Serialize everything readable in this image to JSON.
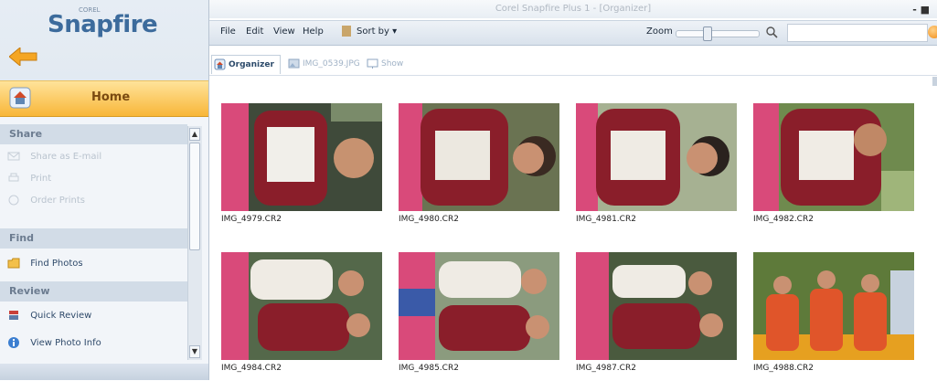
{
  "app": {
    "logo": "Snapfire",
    "logo_small": "COREL",
    "title": "Corel Snapfire Plus 1 - [Organizer]",
    "window_controls": "- ■"
  },
  "sidebar": {
    "home_label": "Home",
    "sections": [
      {
        "title": "Share",
        "items": [
          {
            "label": "Share as E-mail",
            "icon": "mail-icon",
            "enabled": false
          },
          {
            "label": "Print",
            "icon": "print-icon",
            "enabled": false
          },
          {
            "label": "Order Prints",
            "icon": "order-prints-icon",
            "enabled": false
          }
        ]
      },
      {
        "title": "Find",
        "items": [
          {
            "label": "Find Photos",
            "icon": "folder-icon",
            "enabled": true
          }
        ]
      },
      {
        "title": "Review",
        "items": [
          {
            "label": "Quick Review",
            "icon": "quick-review-icon",
            "enabled": true
          },
          {
            "label": "View Photo Info",
            "icon": "info-icon",
            "enabled": true
          }
        ]
      }
    ]
  },
  "menubar": {
    "file": "File",
    "edit": "Edit",
    "view": "View",
    "help": "Help",
    "sort_by": "Sort by ▾",
    "zoom_label": "Zoom",
    "zoom_level": 0.35,
    "search_value": ""
  },
  "tabs": [
    {
      "label": "Organizer",
      "icon": "organizer-icon",
      "active": true
    },
    {
      "label": "IMG_0539.JPG",
      "icon": "photo-icon",
      "active": false
    },
    {
      "label": "Show",
      "icon": "show-icon",
      "active": false
    }
  ],
  "photos": [
    {
      "name": "IMG_4979.CR2"
    },
    {
      "name": "IMG_4980.CR2"
    },
    {
      "name": "IMG_4981.CR2"
    },
    {
      "name": "IMG_4982.CR2"
    },
    {
      "name": "IMG_4984.CR2"
    },
    {
      "name": "IMG_4985.CR2"
    },
    {
      "name": "IMG_4987.CR2"
    },
    {
      "name": "IMG_4988.CR2"
    }
  ],
  "colors": {
    "accent": "#f8b638",
    "jersey": "#8a1e2a",
    "sidebar_bg": "#e6edf4"
  }
}
